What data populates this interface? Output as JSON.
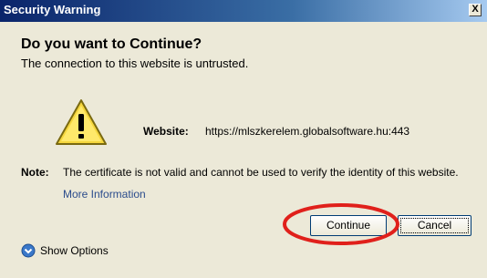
{
  "window": {
    "title": "Security Warning",
    "close_glyph": "X"
  },
  "heading": "Do you want to Continue?",
  "subheading": "The connection to this website is untrusted.",
  "icon": "warning-triangle-icon",
  "website": {
    "label": "Website:",
    "url": "https://mlszkerelem.globalsoftware.hu:443"
  },
  "note": {
    "label": "Note:",
    "text": "The certificate is not valid and cannot be used to verify the identity of this website.",
    "link": "More Information"
  },
  "buttons": {
    "continue": "Continue",
    "cancel": "Cancel"
  },
  "show_options": "Show Options",
  "colors": {
    "highlight": "#e0201b",
    "dialog_bg": "#ece9d8",
    "titlebar": "#0a246a",
    "link": "#2b4c8c"
  }
}
